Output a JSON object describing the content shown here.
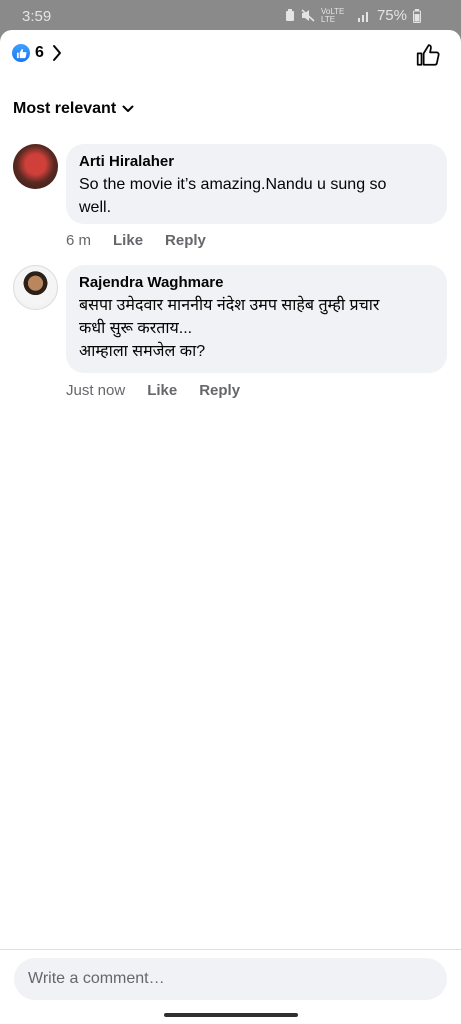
{
  "status": {
    "time": "3:59",
    "network": "VoLTE LTE",
    "battery": "75%"
  },
  "reactions": {
    "count": "6",
    "like_icon": "like-icon",
    "chevron_icon": "chevron-right-icon",
    "thumb_icon": "thumbs-up-icon"
  },
  "sort": {
    "label": "Most relevant",
    "icon": "chevron-down-icon"
  },
  "comments": [
    {
      "author": "Arti Hiralaher",
      "text": "So the movie it’s amazing.Nandu u sung so\nwell.",
      "time": "6 m",
      "like": "Like",
      "reply": "Reply"
    },
    {
      "author": "Rajendra Waghmare",
      "text": "बसपा उमेदवार माननीय नंदेश उमप साहेब तुम्ही प्रचार\nकधी सुरू करताय...\nआम्हाला समजेल का?",
      "time": "Just now",
      "like": "Like",
      "reply": "Reply"
    }
  ],
  "composer": {
    "placeholder": "Write a comment…"
  },
  "colors": {
    "brand": "#1877f2",
    "bubble": "#f0f2f5",
    "meta": "#65676b",
    "text": "#050505"
  }
}
